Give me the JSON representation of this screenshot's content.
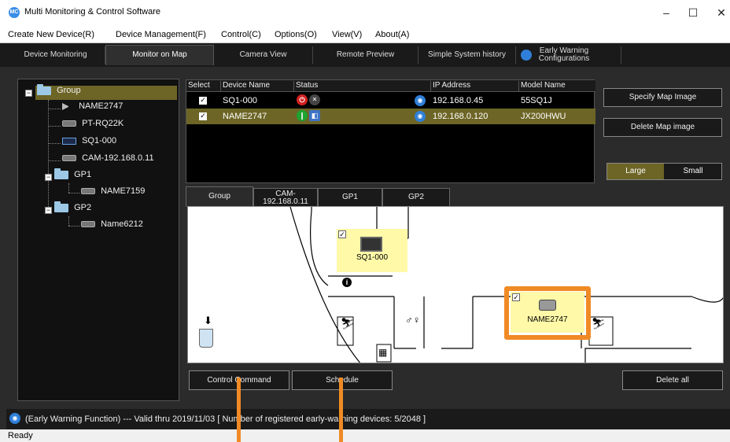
{
  "window": {
    "title": "Multi Monitoring & Control Software",
    "app_icon_text": "MC",
    "minimize": "–",
    "maximize": "☐",
    "close": "✕"
  },
  "menu": [
    "Create New Device(R)",
    "Device Management(F)",
    "Control(C)",
    "Options(O)",
    "View(V)",
    "About(A)"
  ],
  "tabs": [
    "Device Monitoring",
    "Monitor on Map",
    "Camera View",
    "Remote Preview",
    "Simple System history",
    "Early Warning",
    "Configurations"
  ],
  "tree": {
    "root": "Group",
    "items": [
      "NAME2747",
      "PT-RQ22K",
      "SQ1-000",
      "CAM-192.168.0.11",
      "GP1",
      "NAME7159",
      "GP2",
      "Name6212"
    ]
  },
  "table": {
    "headers": [
      "Select",
      "Device Name",
      "Status",
      "IP Address",
      "Model Name"
    ],
    "rows": [
      {
        "check": "✓",
        "name": "SQ1-000",
        "ip": "192.168.0.45",
        "model": "55SQ1J"
      },
      {
        "check": "✓",
        "name": "NAME2747",
        "ip": "192.168.0.120",
        "model": "JX200HWU"
      }
    ]
  },
  "buttons": {
    "specify_map": "Specify Map Image",
    "delete_map": "Delete Map image",
    "large": "Large",
    "small": "Small",
    "control_command": "Control Command",
    "schedule": "Schedule",
    "delete_all": "Delete all"
  },
  "map_tabs": [
    "Group",
    "CAM-",
    "192.168.0.11",
    "GP1",
    "GP2"
  ],
  "map": {
    "device1": "SQ1-000",
    "device2": "NAME2747",
    "check": "✓"
  },
  "status": {
    "early_warning": "(Early Warning Function) --- Valid thru 2019/11/03  [ Number of registered early-warning devices: 5/2048 ]",
    "ready": "Ready"
  },
  "colors": {
    "selected_row": "#6d6526",
    "highlight": "#f08a24",
    "map_device_bg": "#fff9a8"
  }
}
